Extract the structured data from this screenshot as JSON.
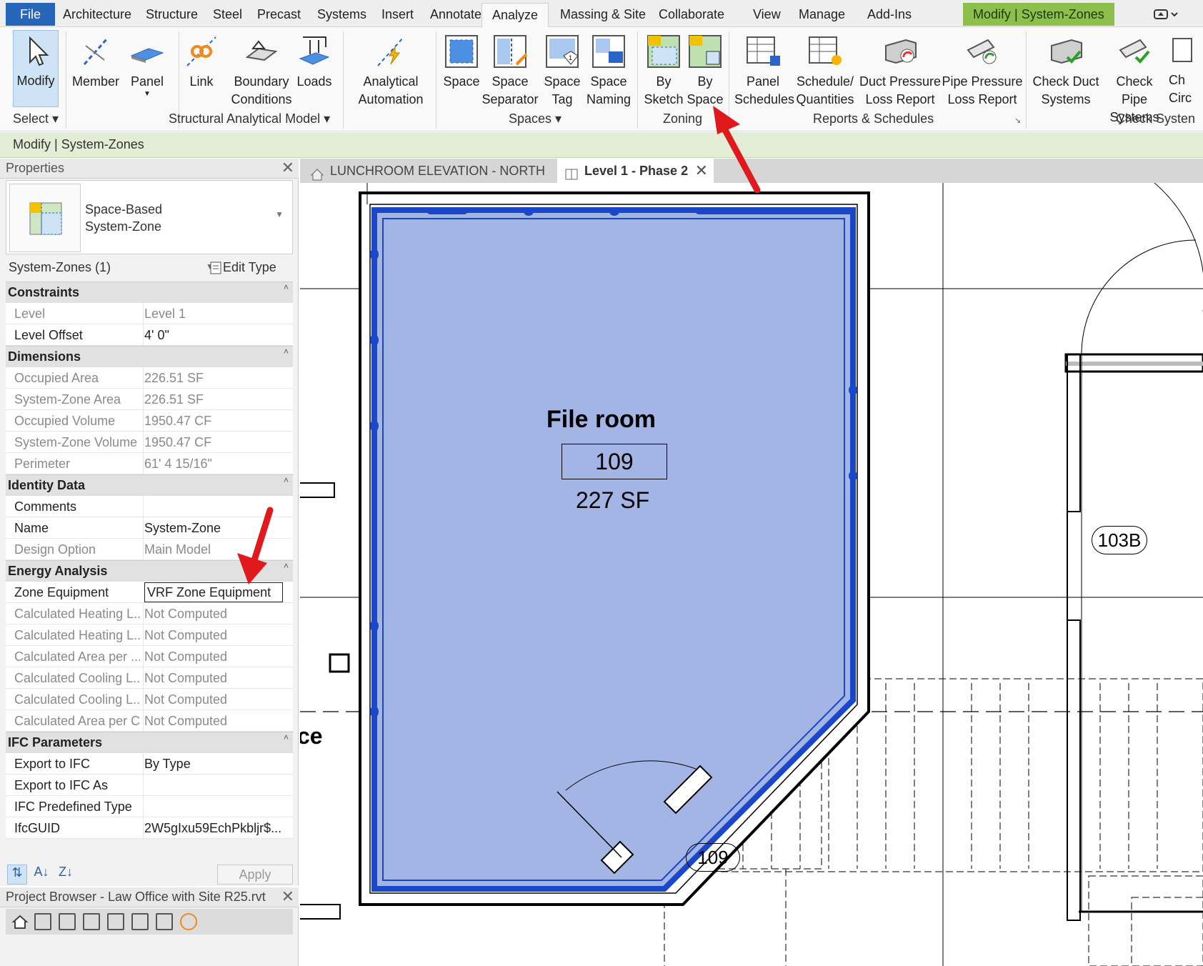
{
  "ribbon_tabs": [
    "File",
    "Architecture",
    "Structure",
    "Steel",
    "Precast",
    "Systems",
    "Insert",
    "Annotate",
    "Analyze",
    "Massing & Site",
    "Collaborate",
    "View",
    "Manage",
    "Add-Ins",
    "Modify | System-Zones"
  ],
  "active_tab": "Analyze",
  "ribbon": {
    "buttons": {
      "modify": "Modify",
      "member": "Member",
      "panel": "Panel",
      "link": "Link",
      "boundary": "Boundary\nConditions",
      "loads": "Loads",
      "analytical_automation": "Analytical\nAutomation",
      "space": "Space",
      "space_separator": "Space\nSeparator",
      "space_tag": "Space\nTag",
      "space_naming": "Space\nNaming",
      "by_sketch": "By\nSketch",
      "by_space": "By\nSpace",
      "panel_schedules": "Panel\nSchedules",
      "schedule_quantities": "Schedule/\nQuantities",
      "duct_pressure": "Duct Pressure\nLoss Report",
      "pipe_pressure": "Pipe Pressure\nLoss Report",
      "check_duct": "Check Duct\nSystems",
      "check_pipe": "Check Pipe\nSystems",
      "check_circuits": "Ch\nCirc"
    },
    "panels": {
      "select": "Select",
      "structural": "Structural Analytical Model",
      "spaces": "Spaces",
      "zoning": "Zoning",
      "reports": "Reports & Schedules",
      "check": "Check Systen"
    }
  },
  "options_bar": {
    "label": "Modify | System-Zones"
  },
  "properties": {
    "title": "Properties",
    "type_name": "Space-Based\nSystem-Zone",
    "instance_filter": "System-Zones (1)",
    "edit_type": "Edit Type",
    "groups": {
      "constraints": "Constraints",
      "dimensions": "Dimensions",
      "identity": "Identity Data",
      "energy": "Energy Analysis",
      "ifc": "IFC Parameters"
    },
    "rows": {
      "level": [
        "Level",
        "Level 1"
      ],
      "level_offset": [
        "Level Offset",
        "4'  0\""
      ],
      "occupied_area": [
        "Occupied Area",
        "226.51 SF"
      ],
      "system_zone_area": [
        "System-Zone Area",
        "226.51 SF"
      ],
      "occupied_volume": [
        "Occupied Volume",
        "1950.47 CF"
      ],
      "system_zone_volume": [
        "System-Zone Volume",
        "1950.47 CF"
      ],
      "perimeter": [
        "Perimeter",
        "61'  4 15/16\""
      ],
      "comments": [
        "Comments",
        ""
      ],
      "name": [
        "Name",
        "System-Zone"
      ],
      "design_option": [
        "Design Option",
        "Main Model"
      ],
      "zone_equipment": [
        "Zone Equipment",
        "VRF Zone Equipment"
      ],
      "calc_heating_1": [
        "Calculated Heating L...",
        "Not Computed"
      ],
      "calc_heating_2": [
        "Calculated Heating L...",
        "Not Computed"
      ],
      "calc_area_per_1": [
        "Calculated Area per ...",
        "Not Computed"
      ],
      "calc_cooling_1": [
        "Calculated Cooling L...",
        "Not Computed"
      ],
      "calc_cooling_2": [
        "Calculated Cooling L...",
        "Not Computed"
      ],
      "calc_area_per_2": [
        "Calculated Area per C...",
        "Not Computed"
      ],
      "export_ifc": [
        "Export to IFC",
        "By Type"
      ],
      "export_ifc_as": [
        "Export to IFC As",
        ""
      ],
      "ifc_predefined": [
        "IFC Predefined Type",
        ""
      ],
      "ifc_guid": [
        "IfcGUID",
        "2W5gIxu59EchPkbljr$..."
      ]
    },
    "apply_label": "Apply"
  },
  "project_browser": {
    "title": "Project Browser - Law Office with Site R25.rvt"
  },
  "view_tabs": [
    "LUNCHROOM ELEVATION - NORTH",
    "Level 1 - Phase 2"
  ],
  "canvas": {
    "room_name": "File room",
    "room_number": "109",
    "room_area": "227 SF",
    "door_tag_103b": "103B",
    "door_tag_109": "109",
    "partial_text": "ce"
  },
  "colors": {
    "file_tab": "#2765b8",
    "context_tab": "#8cbf4c",
    "options_bar": "#e3ecd4",
    "zone_fill": "#a3b5e5",
    "zone_border": "#1a46c8",
    "annotation_arrow": "#e0191c"
  },
  "icons": [
    "modify-cursor-icon",
    "member-icon",
    "panel-icon",
    "link-icon",
    "boundary-conditions-icon",
    "loads-icon",
    "analytical-automation-icon",
    "space-icon",
    "space-separator-icon",
    "space-tag-icon",
    "space-naming-icon",
    "zone-by-sketch-icon",
    "zone-by-space-icon",
    "panel-schedules-icon",
    "schedule-quantities-icon",
    "duct-pressure-icon",
    "pipe-pressure-icon",
    "check-duct-icon",
    "check-pipe-icon",
    "close-icon",
    "home-icon",
    "edit-type-icon"
  ]
}
